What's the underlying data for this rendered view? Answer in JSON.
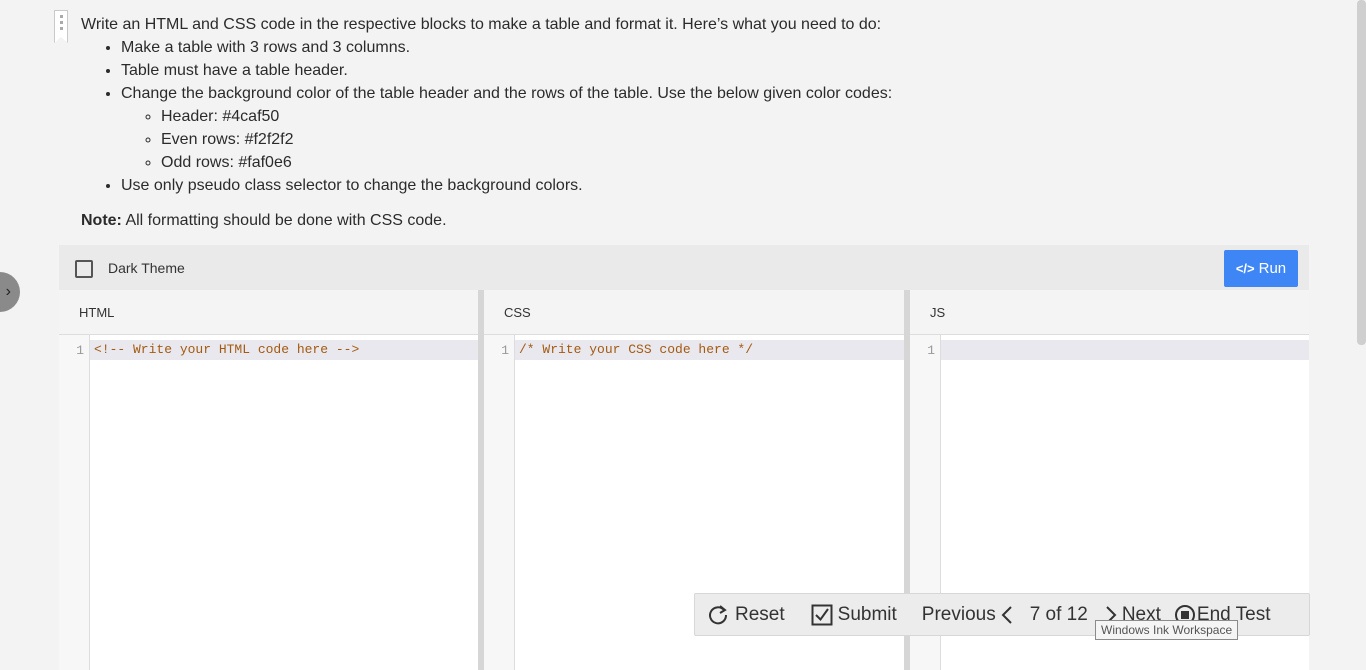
{
  "question": {
    "intro": "Write an HTML and CSS code in the respective blocks to make a table and format it. Here’s what you need to do:",
    "bullets": [
      "Make a table with 3 rows and 3 columns.",
      "Table must have a table header.",
      "Change the background color of the table header and the rows of the table. Use the below given color codes:",
      "Use only pseudo class selector to change the background colors."
    ],
    "color_codes": [
      "Header: #4caf50",
      "Even rows: #f2f2f2",
      "Odd rows: #faf0e6"
    ],
    "note_label": "Note:",
    "note_text": " All formatting should be done with CSS code."
  },
  "editor": {
    "dark_theme_label": "Dark Theme",
    "dark_theme_checked": false,
    "run_label": "Run",
    "run_icon": "code-icon",
    "panes": [
      {
        "title": "HTML",
        "line_number": "1",
        "code": "<!-- Write your HTML code here -->"
      },
      {
        "title": "CSS",
        "line_number": "1",
        "code": "/* Write your CSS code here */"
      },
      {
        "title": "JS",
        "line_number": "1",
        "code": ""
      }
    ]
  },
  "bottom_bar": {
    "reset_label": "Reset",
    "submit_label": "Submit",
    "previous_label": "Previous",
    "page_indicator": "7 of 12",
    "next_label": "Next",
    "end_test_label": "End Test"
  },
  "tooltip": "Windows Ink Workspace",
  "colors": {
    "accent": "#3e86f5",
    "code_comment": "#a55a10",
    "background": "#f3f3f3"
  }
}
